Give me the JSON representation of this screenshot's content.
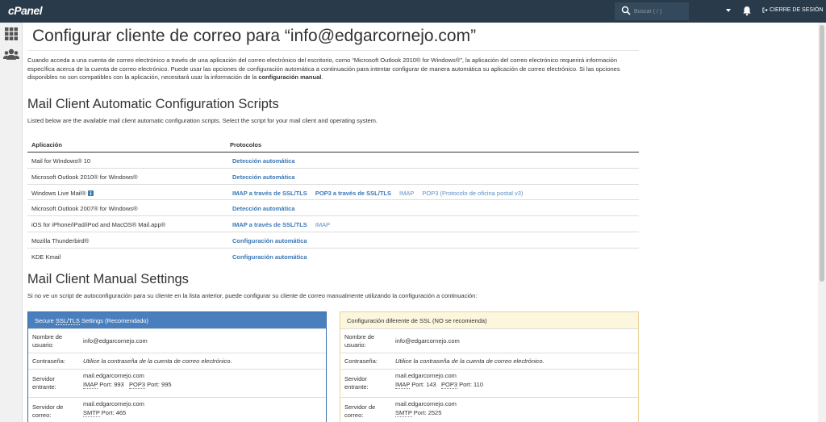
{
  "header": {
    "logo": "cPanel",
    "search_placeholder": "Buscar ( / )",
    "logout": "CIERRE DE SESIÓN"
  },
  "page": {
    "title": "Configurar cliente de correo para “info@edgarcornejo.com”",
    "intro_1": "Cuando acceda a una cuenta de correo electrónico a través de una aplicación del correo electrónico del escritorio, como “Microsoft Outlook 2010® for Windows®”, la aplicación del correo electrónico requerirá información específica acerca de la cuenta de correo electrónico. Puede usar las opciones de configuración automática a continuación para intentar configurar de manera automática su aplicación de correo electrónico. Si las opciones disponibles no son compatibles con la aplicación, necesitará usar la información de la ",
    "intro_bold": "configuración manual",
    "intro_end": "."
  },
  "auto_section": {
    "title": "Mail Client Automatic Configuration Scripts",
    "subtitle": "Listed below are the available mail client automatic configuration scripts. Select the script for your mail client and operating system.",
    "col_app": "Aplicación",
    "col_protocols": "Protocolos",
    "rows": [
      {
        "app": "Mail for Windows® 10",
        "links": [
          "Detección automática"
        ]
      },
      {
        "app": "Microsoft Outlook 2010® for Windows®",
        "links": [
          "Detección automática"
        ]
      },
      {
        "app": "Windows Live Mail®",
        "links": [
          "IMAP a través de SSL/TLS",
          "POP3 a través de SSL/TLS",
          "IMAP",
          "POP3 (Protocolo de oficina postal v3)"
        ]
      },
      {
        "app": "Microsoft Outlook 2007® for Windows®",
        "links": [
          "Detección automática"
        ]
      },
      {
        "app": "iOS for iPhone/iPad/iPod and MacOS® Mail.app®",
        "links": [
          "IMAP a través de SSL/TLS",
          "IMAP"
        ]
      },
      {
        "app": "Mozilla Thunderbird®",
        "links": [
          "Configuración automática"
        ]
      },
      {
        "app": "KDE Kmail",
        "links": [
          "Configuración automática"
        ]
      }
    ]
  },
  "manual_section": {
    "title": "Mail Client Manual Settings",
    "subtitle": "Si no ve un script de autoconfiguración para su cliente en la lista anterior, puede configurar su cliente de correo manualmente utilizando la configuración a continuación:"
  },
  "secure_panel": {
    "title_pre": "Secure ",
    "title_abbr": "SSL/TLS",
    "title_post": " Settings (Recomendado)",
    "username_label_1": "Nombre de",
    "username_label_2": "usuario:",
    "username": "info@edgarcornejo.com",
    "password_label": "Contraseña:",
    "password_hint": "Utilice la contraseña de la cuenta de correo electrónico.",
    "incoming_label_1": "Servidor",
    "incoming_label_2": "entrante:",
    "incoming_host": "mail.edgarcornejo.com",
    "imap": "IMAP",
    "imap_port": "Port: 993",
    "pop3": "POP3",
    "pop3_port": "Port: 995",
    "outgoing_label_1": "Servidor de",
    "outgoing_label_2": "correo:",
    "outgoing_host": "mail.edgarcornejo.com",
    "smtp": "SMTP",
    "smtp_port": "Port: 465"
  },
  "nonssl_panel": {
    "title": "Configuración diferente de SSL (NO se recomienda)",
    "username_label_1": "Nombre de",
    "username_label_2": "usuario:",
    "username": "info@edgarcornejo.com",
    "password_label": "Contraseña:",
    "password_hint": "Utilice la contraseña de la cuenta de correo electrónico.",
    "incoming_label_1": "Servidor",
    "incoming_label_2": "entrante:",
    "incoming_host": "mail.edgarcornejo.com",
    "imap": "IMAP",
    "imap_port": "Port: 143",
    "pop3": "POP3",
    "pop3_port": "Port: 110",
    "outgoing_label_1": "Servidor de",
    "outgoing_label_2": "correo:",
    "outgoing_host": "mail.edgarcornejo.com",
    "smtp": "SMTP",
    "smtp_port": "Port: 2525"
  }
}
